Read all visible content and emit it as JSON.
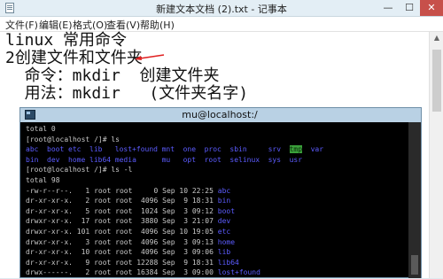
{
  "notepad": {
    "title": "新建文本文档 (2).txt - 记事本",
    "controls": {
      "minimize": "—",
      "maximize": "☐",
      "close": "✕"
    },
    "menu": [
      "文件(F)",
      "编辑(E)",
      "格式(O)",
      "查看(V)",
      "帮助(H)"
    ],
    "lines": [
      "linux 常用命令",
      "",
      "2创建文件和文件夹",
      "  命令：mkdir  创建文件夹",
      "  用法：mkdir   (文件夹名字)"
    ]
  },
  "terminal": {
    "title": "mu@localhost:/",
    "line_total0": "total 0",
    "prompt1": "[root@localhost /]# ls",
    "ls_row1": [
      "abc",
      "boot",
      "etc",
      "lib",
      "lost+found",
      "mnt",
      "one",
      "proc",
      "sbin",
      "srv",
      "tmp",
      "var"
    ],
    "ls_row2": [
      "bin",
      "dev",
      "home",
      "lib64",
      "media",
      "mu",
      "opt",
      "root",
      "selinux",
      "sys",
      "usr"
    ],
    "prompt2": "[root@localhost /]# ls -l",
    "line_total98": "total 98",
    "listing": [
      {
        "perm": "-rw-r--r--.",
        "links": "1",
        "owner": "root",
        "group": "root",
        "size": "0",
        "date": "Sep 10 22:25",
        "name": "abc"
      },
      {
        "perm": "dr-xr-xr-x.",
        "links": "2",
        "owner": "root",
        "group": "root",
        "size": "4096",
        "date": "Sep  9 18:31",
        "name": "bin"
      },
      {
        "perm": "dr-xr-xr-x.",
        "links": "5",
        "owner": "root",
        "group": "root",
        "size": "1024",
        "date": "Sep  3 09:12",
        "name": "boot"
      },
      {
        "perm": "drwxr-xr-x.",
        "links": "17",
        "owner": "root",
        "group": "root",
        "size": "3880",
        "date": "Sep  3 21:07",
        "name": "dev"
      },
      {
        "perm": "drwxr-xr-x.",
        "links": "101",
        "owner": "root",
        "group": "root",
        "size": "4096",
        "date": "Sep 10 19:05",
        "name": "etc"
      },
      {
        "perm": "drwxr-xr-x.",
        "links": "3",
        "owner": "root",
        "group": "root",
        "size": "4096",
        "date": "Sep  3 09:13",
        "name": "home"
      },
      {
        "perm": "dr-xr-xr-x.",
        "links": "10",
        "owner": "root",
        "group": "root",
        "size": "4096",
        "date": "Sep  3 09:06",
        "name": "lib"
      },
      {
        "perm": "dr-xr-xr-x.",
        "links": "9",
        "owner": "root",
        "group": "root",
        "size": "12288",
        "date": "Sep  9 18:31",
        "name": "lib64"
      },
      {
        "perm": "drwx------.",
        "links": "2",
        "owner": "root",
        "group": "root",
        "size": "16384",
        "date": "Sep  3 09:00",
        "name": "lost+found"
      },
      {
        "perm": "drwxr-xr-x.",
        "links": "2",
        "owner": "root",
        "group": "root",
        "size": "4096",
        "date": "Sep 23  2011",
        "name": "media"
      }
    ]
  },
  "colors": {
    "dir_blue": "#5c5cff",
    "link_cyan": "#2ec8d8",
    "tmp_highlight": "#3a9f3a",
    "arrow_red": "#e02020"
  }
}
